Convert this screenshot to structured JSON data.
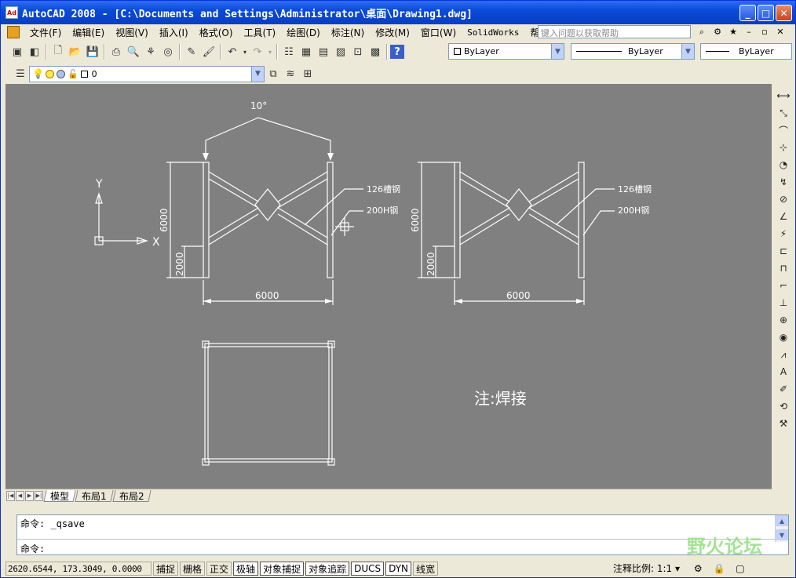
{
  "window": {
    "title": "AutoCAD 2008 - [C:\\Documents and Settings\\Administrator\\桌面\\Drawing1.dwg]",
    "app_icon_text": "Ad",
    "minimize_label": "_",
    "maximize_label": "□",
    "close_label": "✕"
  },
  "menu": {
    "items": [
      "文件(F)",
      "编辑(E)",
      "视图(V)",
      "插入(I)",
      "格式(O)",
      "工具(T)",
      "绘图(D)",
      "标注(N)",
      "修改(M)",
      "窗口(W)",
      "SolidWorks",
      "帮助(H)"
    ],
    "help_placeholder": "键入问题以获取帮助",
    "doc_min": "–",
    "doc_restore": "▫",
    "doc_close": "✕"
  },
  "properties": {
    "color": "ByLayer",
    "linetype": "ByLayer",
    "lineweight": "ByLayer"
  },
  "layers": {
    "current_layer": "0"
  },
  "drawing": {
    "left_frame": {
      "top_label": "10°",
      "height_label": "6000",
      "sub_height_label": "2000",
      "width_label": "6000",
      "callout_1": "126槽钢",
      "callout_2": "200H钢"
    },
    "right_frame": {
      "height_label": "6000",
      "sub_height_label": "2000",
      "width_label": "6000",
      "callout_1": "126槽钢",
      "callout_2": "200H钢"
    },
    "ucs": {
      "x_label": "X",
      "y_label": "Y"
    },
    "note": "注:焊接"
  },
  "tabs": {
    "items": [
      "模型",
      "布局1",
      "布局2"
    ],
    "active": "模型"
  },
  "command": {
    "history": "命令: _qsave",
    "prompt": "命令:"
  },
  "status": {
    "coordinates": "2620.6544, 173.3049, 0.0000",
    "toggles": [
      "捕捉",
      "栅格",
      "正交",
      "极轴",
      "对象捕捉",
      "对象追踪",
      "DUCS",
      "DYN",
      "线宽"
    ],
    "annotation_scale_label": "注释比例:",
    "annotation_scale_value": "1:1"
  },
  "watermark": "野火论坛"
}
